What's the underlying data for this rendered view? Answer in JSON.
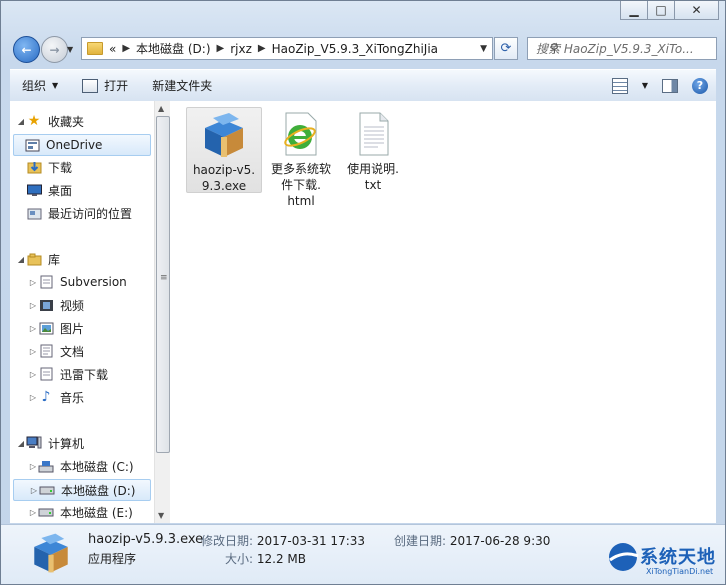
{
  "window": {
    "address": {
      "prefix": "«",
      "crumbs": [
        "本地磁盘 (D:)",
        "rjxz",
        "HaoZip_V5.9.3_XiTongZhiJia"
      ]
    },
    "search_placeholder": "搜索 HaoZip_V5.9.3_XiTo..."
  },
  "toolbar": {
    "organize": "组织",
    "open": "打开",
    "new_folder": "新建文件夹"
  },
  "sidebar": {
    "favorites": "收藏夹",
    "onedrive": "OneDrive",
    "downloads": "下载",
    "desktop": "桌面",
    "recent": "最近访问的位置",
    "libraries": "库",
    "subversion": "Subversion",
    "videos": "视频",
    "pictures": "图片",
    "documents": "文档",
    "xunlei": "迅雷下载",
    "music": "音乐",
    "computer": "计算机",
    "drive_c": "本地磁盘 (C:)",
    "drive_d": "本地磁盘 (D:)",
    "drive_e": "本地磁盘 (E:)"
  },
  "files": [
    {
      "name_line1": "haozip-v5.",
      "name_line2": "9.3.exe",
      "name_line3": ""
    },
    {
      "name_line1": "更多系统软",
      "name_line2": "件下载.",
      "name_line3": "html"
    },
    {
      "name_line1": "使用说明.",
      "name_line2": "txt",
      "name_line3": ""
    }
  ],
  "details": {
    "name": "haozip-v5.9.3.exe",
    "type": "应用程序",
    "modified_label": "修改日期:",
    "modified": "2017-03-31 17:33",
    "size_label": "大小:",
    "size": "12.2 MB",
    "created_label": "创建日期:",
    "created": "2017-06-28 9:30"
  },
  "watermark": {
    "title": "系统天地",
    "url": "XiTongTianDi.net"
  },
  "colors": {
    "accent": "#1d61b8",
    "selection": "#d8e9fa",
    "chrome": "#c7d8ec"
  }
}
